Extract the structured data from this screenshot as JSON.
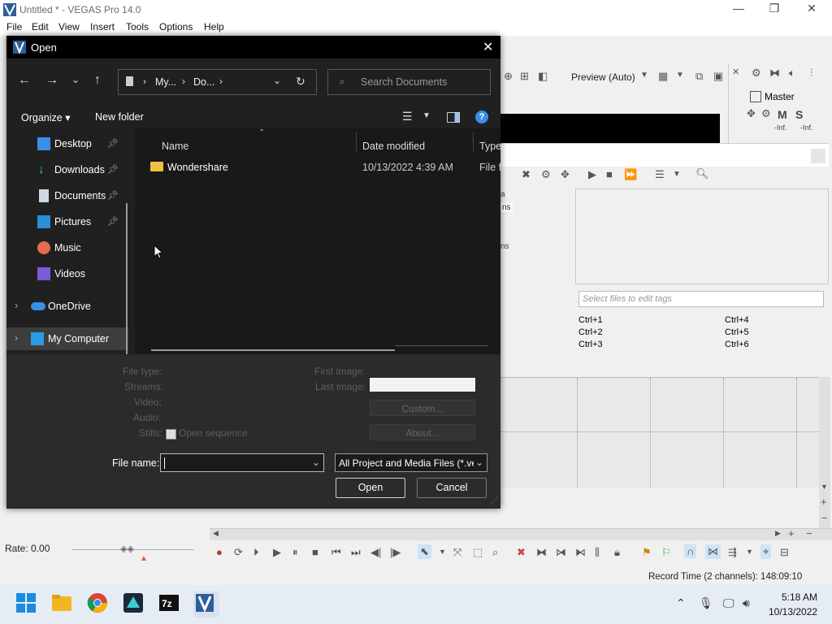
{
  "app": {
    "title": "Untitled * - VEGAS Pro 14.0",
    "menu": [
      "File",
      "Edit",
      "View",
      "Insert",
      "Tools",
      "Options",
      "Help"
    ],
    "preview_mode": "Preview (Auto)",
    "master_label": "Master",
    "master_m": "M",
    "master_s": "S",
    "inf_left": "-Inf.",
    "inf_right": "-Inf.",
    "tags_placeholder": "Select files to edit tags",
    "shortcuts_left": [
      "Ctrl+1",
      "Ctrl+2",
      "Ctrl+3"
    ],
    "shortcuts_right": [
      "Ctrl+4",
      "Ctrl+5",
      "Ctrl+6"
    ],
    "partial_text_1": "a",
    "partial_text_2": "ns",
    "partial_text_3": "ns",
    "rate": "Rate: 0.00",
    "record_time": "Record Time (2 channels): 148:09:10"
  },
  "taskbar": {
    "time": "5:18 AM",
    "date": "10/13/2022",
    "icons": [
      "windows-start-icon",
      "file-explorer-icon",
      "chrome-icon",
      "wondershare-icon",
      "7zip-icon",
      "vegas-icon"
    ]
  },
  "dialog": {
    "title": "Open",
    "breadcrumb": [
      "My...",
      "Do..."
    ],
    "search_placeholder": "Search Documents",
    "organize": "Organize",
    "new_folder": "New folder",
    "nav_items": [
      {
        "label": "Desktop",
        "icon": "desktop-icon",
        "pinned": true
      },
      {
        "label": "Downloads",
        "icon": "downloads-icon",
        "pinned": true
      },
      {
        "label": "Documents",
        "icon": "documents-icon",
        "pinned": true
      },
      {
        "label": "Pictures",
        "icon": "pictures-icon",
        "pinned": true
      },
      {
        "label": "Music",
        "icon": "music-icon",
        "pinned": false
      },
      {
        "label": "Videos",
        "icon": "videos-icon",
        "pinned": false
      },
      {
        "label": "OneDrive",
        "icon": "onedrive-icon",
        "pinned": false
      },
      {
        "label": "My Computer",
        "icon": "computer-icon",
        "pinned": false
      }
    ],
    "columns": {
      "name": "Name",
      "date": "Date modified",
      "type": "Type"
    },
    "files": [
      {
        "name": "Wondershare",
        "date": "10/13/2022 4:39 AM",
        "type": "File fo"
      }
    ],
    "props": {
      "file_type": "File type:",
      "streams": "Streams:",
      "video": "Video:",
      "audio": "Audio:",
      "stills": "Stills:",
      "open_sequence": "Open sequence",
      "first_image": "First image:",
      "last_image": "Last image:",
      "custom": "Custom...",
      "about": "About..."
    },
    "file_name_label": "File name:",
    "file_name_value": "",
    "filter": "All Project and Media Files (*.ve",
    "open_button": "Open",
    "cancel_button": "Cancel"
  }
}
